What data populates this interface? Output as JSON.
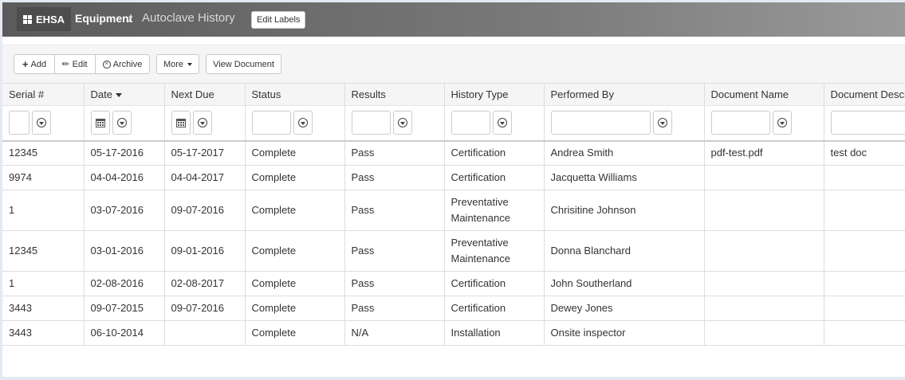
{
  "header": {
    "brand": "EHSA",
    "breadcrumb_link": "Equipment",
    "breadcrumb_sep": "/",
    "page_title": "Autoclave History",
    "edit_labels": "Edit Labels"
  },
  "toolbar": {
    "add": "Add",
    "edit": "Edit",
    "archive": "Archive",
    "more": "More",
    "view_document": "View Document"
  },
  "columns": [
    "Serial #",
    "Date",
    "Next Due",
    "Status",
    "Results",
    "History Type",
    "Performed By",
    "Document Name",
    "Document Description"
  ],
  "rows": [
    [
      "12345",
      "05-17-2016",
      "05-17-2017",
      "Complete",
      "Pass",
      "Certification",
      "Andrea Smith",
      "pdf-test.pdf",
      "test doc"
    ],
    [
      "9974",
      "04-04-2016",
      "04-04-2017",
      "Complete",
      "Pass",
      "Certification",
      "Jacquetta Williams",
      "",
      ""
    ],
    [
      "1",
      "03-07-2016",
      "09-07-2016",
      "Complete",
      "Pass",
      "Preventative Maintenance",
      "Chrisitine Johnson",
      "",
      ""
    ],
    [
      "12345",
      "03-01-2016",
      "09-01-2016",
      "Complete",
      "Pass",
      "Preventative Maintenance",
      "Donna Blanchard",
      "",
      ""
    ],
    [
      "1",
      "02-08-2016",
      "02-08-2017",
      "Complete",
      "Pass",
      "Certification",
      "John Southerland",
      "",
      ""
    ],
    [
      "3443",
      "09-07-2015",
      "09-07-2016",
      "Complete",
      "Pass",
      "Certification",
      "Dewey Jones",
      "",
      ""
    ],
    [
      "3443",
      "06-10-2014",
      "",
      "Complete",
      "N/A",
      "Installation",
      "Onsite inspector",
      "",
      ""
    ]
  ]
}
